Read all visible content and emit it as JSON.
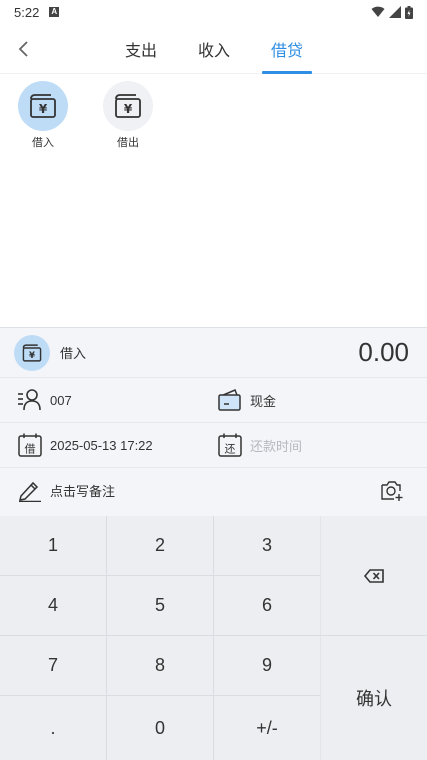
{
  "status_bar": {
    "time": "5:22",
    "notif_glyph": "A"
  },
  "nav": {
    "back_icon": "chevron-left-icon",
    "tabs": [
      {
        "label": "支出",
        "active": false
      },
      {
        "label": "收入",
        "active": false
      },
      {
        "label": "借贷",
        "active": true
      }
    ]
  },
  "categories": [
    {
      "label": "借入",
      "icon": "wallet-yen-icon",
      "selected": true
    },
    {
      "label": "借出",
      "icon": "wallet-yen-icon",
      "selected": false
    }
  ],
  "entry": {
    "category_label": "借入",
    "amount": "0.00",
    "person": "007",
    "account": "现金",
    "borrow_date": "2025-05-13 17:22",
    "repay_placeholder": "还款时间",
    "remark_placeholder": "点击写备注",
    "borrow_badge": "借",
    "repay_badge": "还"
  },
  "keypad": {
    "keys": [
      "1",
      "2",
      "3",
      "4",
      "5",
      "6",
      "7",
      "8",
      "9",
      ".",
      "0",
      "+/-"
    ],
    "confirm": "确认",
    "delete_icon": "backspace-icon"
  },
  "colors": {
    "accent": "#2f8fe4",
    "selected_bg": "#bfdcf7",
    "panel_bg": "#f4f5f9"
  }
}
